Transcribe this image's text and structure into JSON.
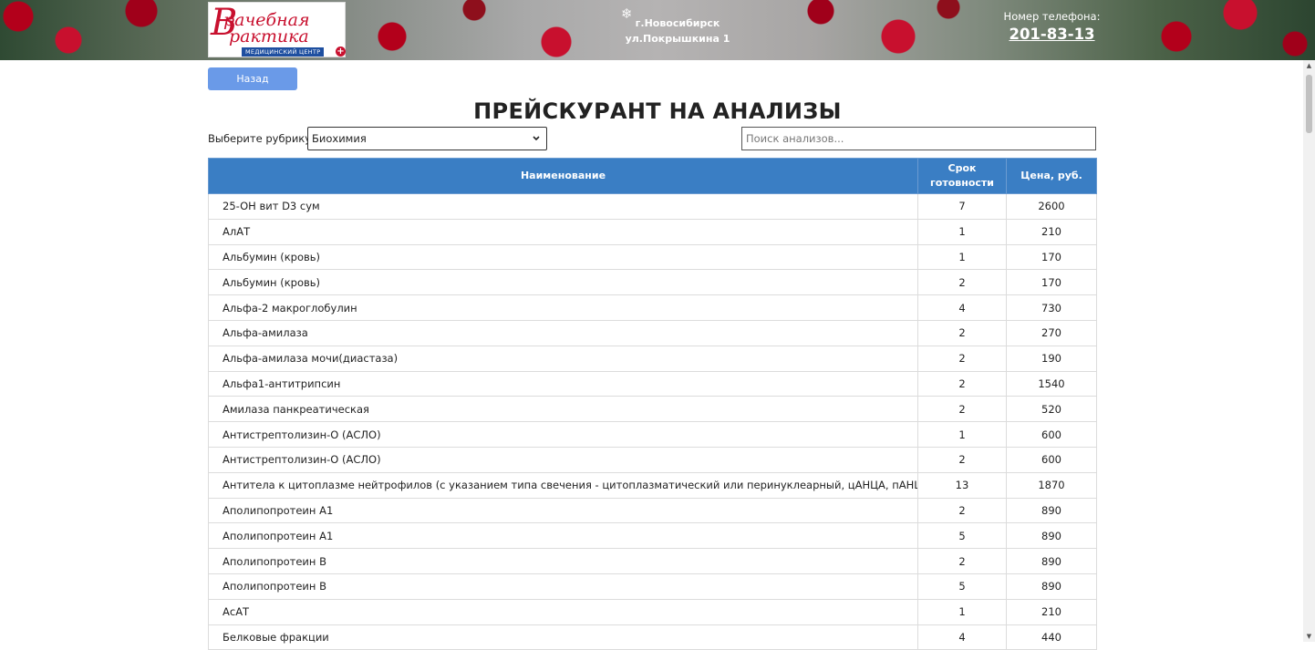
{
  "header": {
    "logo": {
      "line1": "рачебная",
      "line2": "рактика",
      "big_letter": "В",
      "subtitle": "МЕДИЦИНСКИЙ ЦЕНТР"
    },
    "city": "г.Новосибирск",
    "address": "ул.Покрышкина 1",
    "phone_label": "Номер телефона:",
    "phone": "201-83-13"
  },
  "back_button": "Назад",
  "page_title": "ПРЕЙСКУРАНТ НА АНАЛИЗЫ",
  "filters": {
    "rubric_label": "Выберите рубрику:",
    "rubric_value": "Биохимия",
    "search_placeholder": "Поиск анализов..."
  },
  "table": {
    "columns": [
      "Наименование",
      "Срок готовности",
      "Цена, руб."
    ],
    "col_deadline_line1": "Срок",
    "col_deadline_line2": "готовности",
    "rows": [
      {
        "name": "25-OH вит D3 сум",
        "days": "7",
        "price": "2600"
      },
      {
        "name": "АлАТ",
        "days": "1",
        "price": "210"
      },
      {
        "name": "Альбумин (кровь)",
        "days": "1",
        "price": "170"
      },
      {
        "name": "Альбумин (кровь)",
        "days": "2",
        "price": "170"
      },
      {
        "name": "Альфа-2 макроглобулин",
        "days": "4",
        "price": "730"
      },
      {
        "name": "Альфа-амилаза",
        "days": "2",
        "price": "270"
      },
      {
        "name": "Альфа-амилаза мочи(диастаза)",
        "days": "2",
        "price": "190"
      },
      {
        "name": "Альфа1-антитрипсин",
        "days": "2",
        "price": "1540"
      },
      {
        "name": "Амилаза панкреатическая",
        "days": "2",
        "price": "520"
      },
      {
        "name": "Антистрептолизин-О (АСЛО)",
        "days": "1",
        "price": "600"
      },
      {
        "name": "Антистрептолизин-О (АСЛО)",
        "days": "2",
        "price": "600"
      },
      {
        "name": "Антитела к цитоплазме нейтрофилов (с указанием типа свечения - цитоплазматический или перинуклеарный, цАНЦА, пАНЦА), IgG",
        "days": "13",
        "price": "1870"
      },
      {
        "name": "Аполипопротеин А1",
        "days": "2",
        "price": "890"
      },
      {
        "name": "Аполипопротеин А1",
        "days": "5",
        "price": "890"
      },
      {
        "name": "Аполипопротеин В",
        "days": "2",
        "price": "890"
      },
      {
        "name": "Аполипопротеин В",
        "days": "5",
        "price": "890"
      },
      {
        "name": "АсАТ",
        "days": "1",
        "price": "210"
      },
      {
        "name": "Белковые фракции",
        "days": "4",
        "price": "440"
      }
    ]
  },
  "colors": {
    "table_header": "#3a7ec4",
    "back_button": "#6a9ae8",
    "logo_red": "#c8102e",
    "logo_blue": "#1e4fa0"
  }
}
